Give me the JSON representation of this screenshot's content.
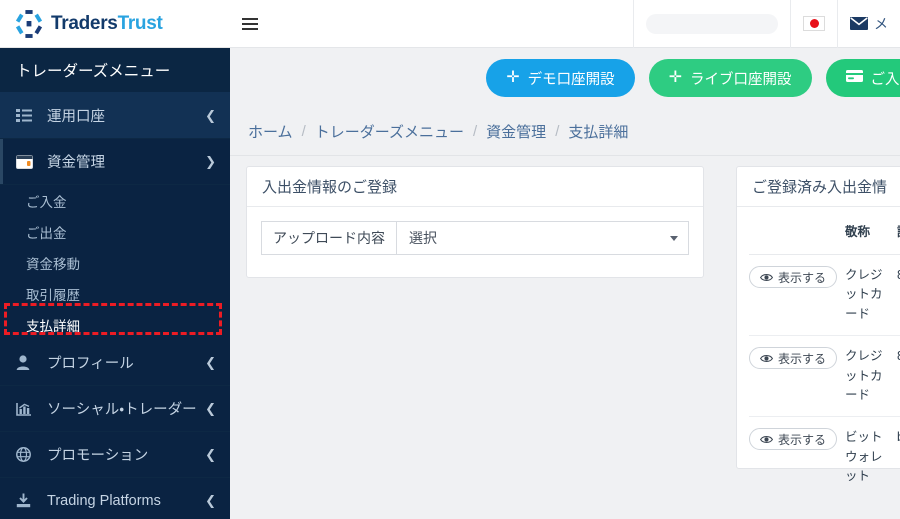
{
  "brand": {
    "name_part1": "Traders",
    "name_part2": "Trust",
    "logo_icon": "hexagon-ring-logo",
    "color_dark": "#123a6b",
    "color_light": "#29a3e0"
  },
  "sidebar": {
    "menu_title": "トレーダーズメニュー",
    "items": [
      {
        "label": "運用口座",
        "icon": "list-icon",
        "chevron": "chevron-left-icon",
        "expanded": false
      },
      {
        "label": "資金管理",
        "icon": "wallet-icon",
        "chevron": "chevron-down-icon",
        "expanded": true
      }
    ],
    "sub_items": [
      {
        "label": "ご入金",
        "current": false
      },
      {
        "label": "ご出金",
        "current": false
      },
      {
        "label": "資金移動",
        "current": false
      },
      {
        "label": "取引履歴",
        "current": false
      },
      {
        "label": "支払詳細",
        "current": true
      }
    ],
    "items_after": [
      {
        "label": "プロフィール",
        "icon": "user-icon",
        "chevron": "chevron-left-icon"
      },
      {
        "label": "ソーシャル・トレーダー",
        "icon": "chart-icon",
        "chevron": "chevron-left-icon"
      },
      {
        "label": "プロモーション",
        "icon": "globe-icon",
        "chevron": "chevron-left-icon"
      },
      {
        "label": "Trading Platforms",
        "icon": "download-icon",
        "chevron": "chevron-left-icon"
      }
    ],
    "highlight_color": "#ec1c24"
  },
  "header": {
    "menu_toggle_icon": "hamburger-icon",
    "account_value": "",
    "language_icon": "japan-flag-icon",
    "mail_icon": "envelope-icon",
    "mail_label": "メ"
  },
  "actions": {
    "demo": {
      "label": "デモ口座開設",
      "icon": "plus-icon",
      "color": "#17a2e8"
    },
    "live": {
      "label": "ライブ口座開設",
      "icon": "plus-icon",
      "color": "#2ecc82"
    },
    "deposit": {
      "label": "ご入金",
      "icon": "credit-card-icon",
      "color": "#23c97b"
    }
  },
  "breadcrumb": {
    "separator": "/",
    "items": [
      {
        "label": "ホーム",
        "current": false
      },
      {
        "label": "トレーダーズメニュー",
        "current": false
      },
      {
        "label": "資金管理",
        "current": false
      },
      {
        "label": "支払詳細",
        "current": true
      }
    ]
  },
  "left_card": {
    "title": "入出金情報のご登録",
    "field": {
      "addon_label": "アップロード内容",
      "selected_value": "選択",
      "caret_icon": "caret-down-icon"
    }
  },
  "right_card": {
    "title": "ご登録済み入出金情",
    "table": {
      "headers": [
        "",
        "敬称",
        "詳"
      ],
      "rows": [
        {
          "action_label": "表示する",
          "action_icon": "eye-icon",
          "name": "クレジットカード",
          "detail": "8"
        },
        {
          "action_label": "表示する",
          "action_icon": "eye-icon",
          "name": "クレジットカード",
          "detail": "8"
        },
        {
          "action_label": "表示する",
          "action_icon": "eye-icon",
          "name": "ビットウォレット",
          "detail": "b"
        }
      ]
    }
  }
}
